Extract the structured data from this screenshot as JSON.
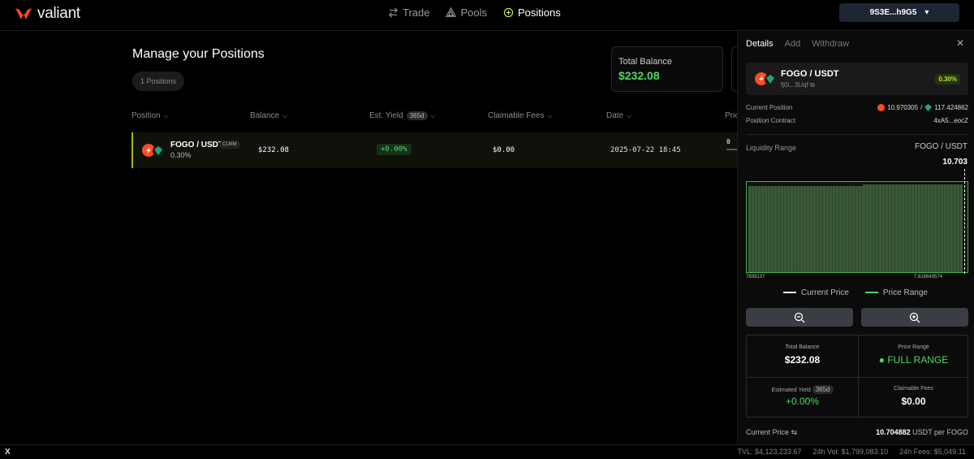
{
  "app": {
    "name": "valiant"
  },
  "nav": {
    "items": [
      {
        "label": "Trade",
        "icon": "swap-icon"
      },
      {
        "label": "Pools",
        "icon": "pools-icon"
      },
      {
        "label": "Positions",
        "icon": "positions-icon"
      }
    ]
  },
  "wallet": {
    "address": "9S3E...h9G5"
  },
  "main": {
    "title": "Manage your Positions",
    "count": "1 Positions",
    "total_balance_label": "Total Balance",
    "total_balance": "$232.08",
    "columns": {
      "position": "Position",
      "balance": "Balance",
      "yield": "Est. Yield",
      "yield_badge": "365d",
      "fees": "Claimable Fees",
      "date": "Date",
      "price": "Pric"
    }
  },
  "row": {
    "pair": "FOGO / USDT",
    "type": "CLMM",
    "fee": "0.30%",
    "balance": "$232.08",
    "yield": "+0.00%",
    "fees": "$0.00",
    "date": "2025-07-22 18:45",
    "price": "0"
  },
  "panel": {
    "tabs": [
      "Details",
      "Add",
      "Withdraw"
    ],
    "pair": "FOGO / USDT",
    "address": "fj0i...3Uqf",
    "fee": "0.30%",
    "current_position_label": "Current Position",
    "fogo_amount": "10.970305",
    "sep": "/",
    "usdt_amount": "117.424862",
    "contract_label": "Position Contract",
    "contract": "4xA5...eocZ",
    "liquidity_label": "Liquidity Range",
    "liquidity_pair": "FOGO / USDT",
    "current_value": "10.703",
    "axis_left": "7839137",
    "axis_right": "7.818649574",
    "legend_current": "Current Price",
    "legend_range": "Price Range",
    "stats": {
      "total_balance_label": "Total Balance",
      "total_balance": "$232.08",
      "price_range_label": "Price Range",
      "price_range": "FULL RANGE",
      "est_yield_label": "Estimated Yield",
      "est_yield_badge": "365d",
      "est_yield": "+0.00%",
      "fees_label": "Claimable Fees",
      "fees": "$0.00"
    },
    "current_price_label": "Current Price",
    "current_price_value": "10.704882",
    "current_price_unit": "USDT per FOGO"
  },
  "footer": {
    "tvl": "TVL: $4,123,233.67",
    "vol": "24h Vol: $1,799,083.10",
    "fees": "24h Fees: $5,049.11"
  },
  "colors": {
    "accent_green": "#4cd964",
    "row_border": "#a1b91f",
    "fogo": "#ff4b1f",
    "usdt": "#26a17b"
  }
}
